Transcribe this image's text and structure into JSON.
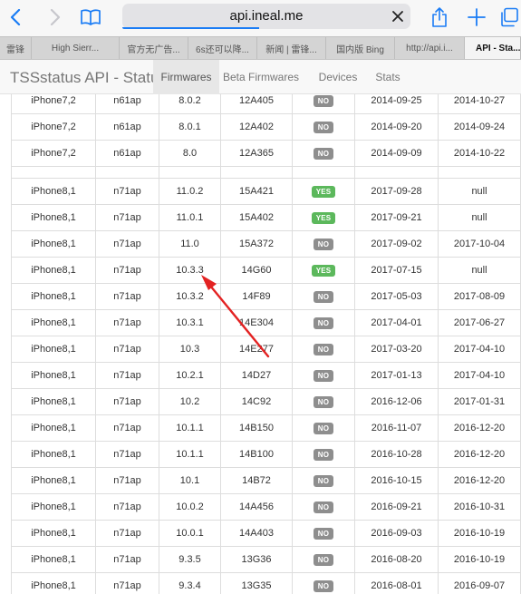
{
  "browser": {
    "url": "api.ineal.me",
    "tabs": [
      {
        "label": "雷锋",
        "active": false
      },
      {
        "label": "High Sierr...",
        "active": false
      },
      {
        "label": "官方无广告...",
        "active": false
      },
      {
        "label": "6s还可以降...",
        "active": false
      },
      {
        "label": "新闻 | 雷锋...",
        "active": false
      },
      {
        "label": "国内版 Bing",
        "active": false
      },
      {
        "label": "http://api.i...",
        "active": false
      },
      {
        "label": "API - Sta...",
        "active": true
      }
    ]
  },
  "app": {
    "brand": "TSSstatus API - Status",
    "nav": [
      {
        "label": "Firmwares",
        "active": true
      },
      {
        "label": "Beta Firmwares",
        "active": false
      },
      {
        "label": "Devices",
        "active": false
      },
      {
        "label": "Stats",
        "active": false
      }
    ]
  },
  "colors": {
    "signed_yes": "#5cb85c",
    "signed_no": "#8e8e8e",
    "arrow": "#e32222"
  },
  "rows": [
    [
      "iPhone7,2",
      "n61ap",
      "8.0.2",
      "12A405",
      "NO",
      "2014-09-25",
      "2014-10-27"
    ],
    [
      "iPhone7,2",
      "n61ap",
      "8.0.1",
      "12A402",
      "NO",
      "2014-09-20",
      "2014-09-24"
    ],
    [
      "iPhone7,2",
      "n61ap",
      "8.0",
      "12A365",
      "NO",
      "2014-09-09",
      "2014-10-22"
    ],
    null,
    [
      "iPhone8,1",
      "n71ap",
      "11.0.2",
      "15A421",
      "YES",
      "2017-09-28",
      "null"
    ],
    [
      "iPhone8,1",
      "n71ap",
      "11.0.1",
      "15A402",
      "YES",
      "2017-09-21",
      "null"
    ],
    [
      "iPhone8,1",
      "n71ap",
      "11.0",
      "15A372",
      "NO",
      "2017-09-02",
      "2017-10-04"
    ],
    [
      "iPhone8,1",
      "n71ap",
      "10.3.3",
      "14G60",
      "YES",
      "2017-07-15",
      "null"
    ],
    [
      "iPhone8,1",
      "n71ap",
      "10.3.2",
      "14F89",
      "NO",
      "2017-05-03",
      "2017-08-09"
    ],
    [
      "iPhone8,1",
      "n71ap",
      "10.3.1",
      "14E304",
      "NO",
      "2017-04-01",
      "2017-06-27"
    ],
    [
      "iPhone8,1",
      "n71ap",
      "10.3",
      "14E277",
      "NO",
      "2017-03-20",
      "2017-04-10"
    ],
    [
      "iPhone8,1",
      "n71ap",
      "10.2.1",
      "14D27",
      "NO",
      "2017-01-13",
      "2017-04-10"
    ],
    [
      "iPhone8,1",
      "n71ap",
      "10.2",
      "14C92",
      "NO",
      "2016-12-06",
      "2017-01-31"
    ],
    [
      "iPhone8,1",
      "n71ap",
      "10.1.1",
      "14B150",
      "NO",
      "2016-11-07",
      "2016-12-20"
    ],
    [
      "iPhone8,1",
      "n71ap",
      "10.1.1",
      "14B100",
      "NO",
      "2016-10-28",
      "2016-12-20"
    ],
    [
      "iPhone8,1",
      "n71ap",
      "10.1",
      "14B72",
      "NO",
      "2016-10-15",
      "2016-12-20"
    ],
    [
      "iPhone8,1",
      "n71ap",
      "10.0.2",
      "14A456",
      "NO",
      "2016-09-21",
      "2016-10-31"
    ],
    [
      "iPhone8,1",
      "n71ap",
      "10.0.1",
      "14A403",
      "NO",
      "2016-09-03",
      "2016-10-19"
    ],
    [
      "iPhone8,1",
      "n71ap",
      "9.3.5",
      "13G36",
      "NO",
      "2016-08-20",
      "2016-10-19"
    ],
    [
      "iPhone8,1",
      "n71ap",
      "9.3.4",
      "13G35",
      "NO",
      "2016-08-01",
      "2016-09-07"
    ]
  ]
}
